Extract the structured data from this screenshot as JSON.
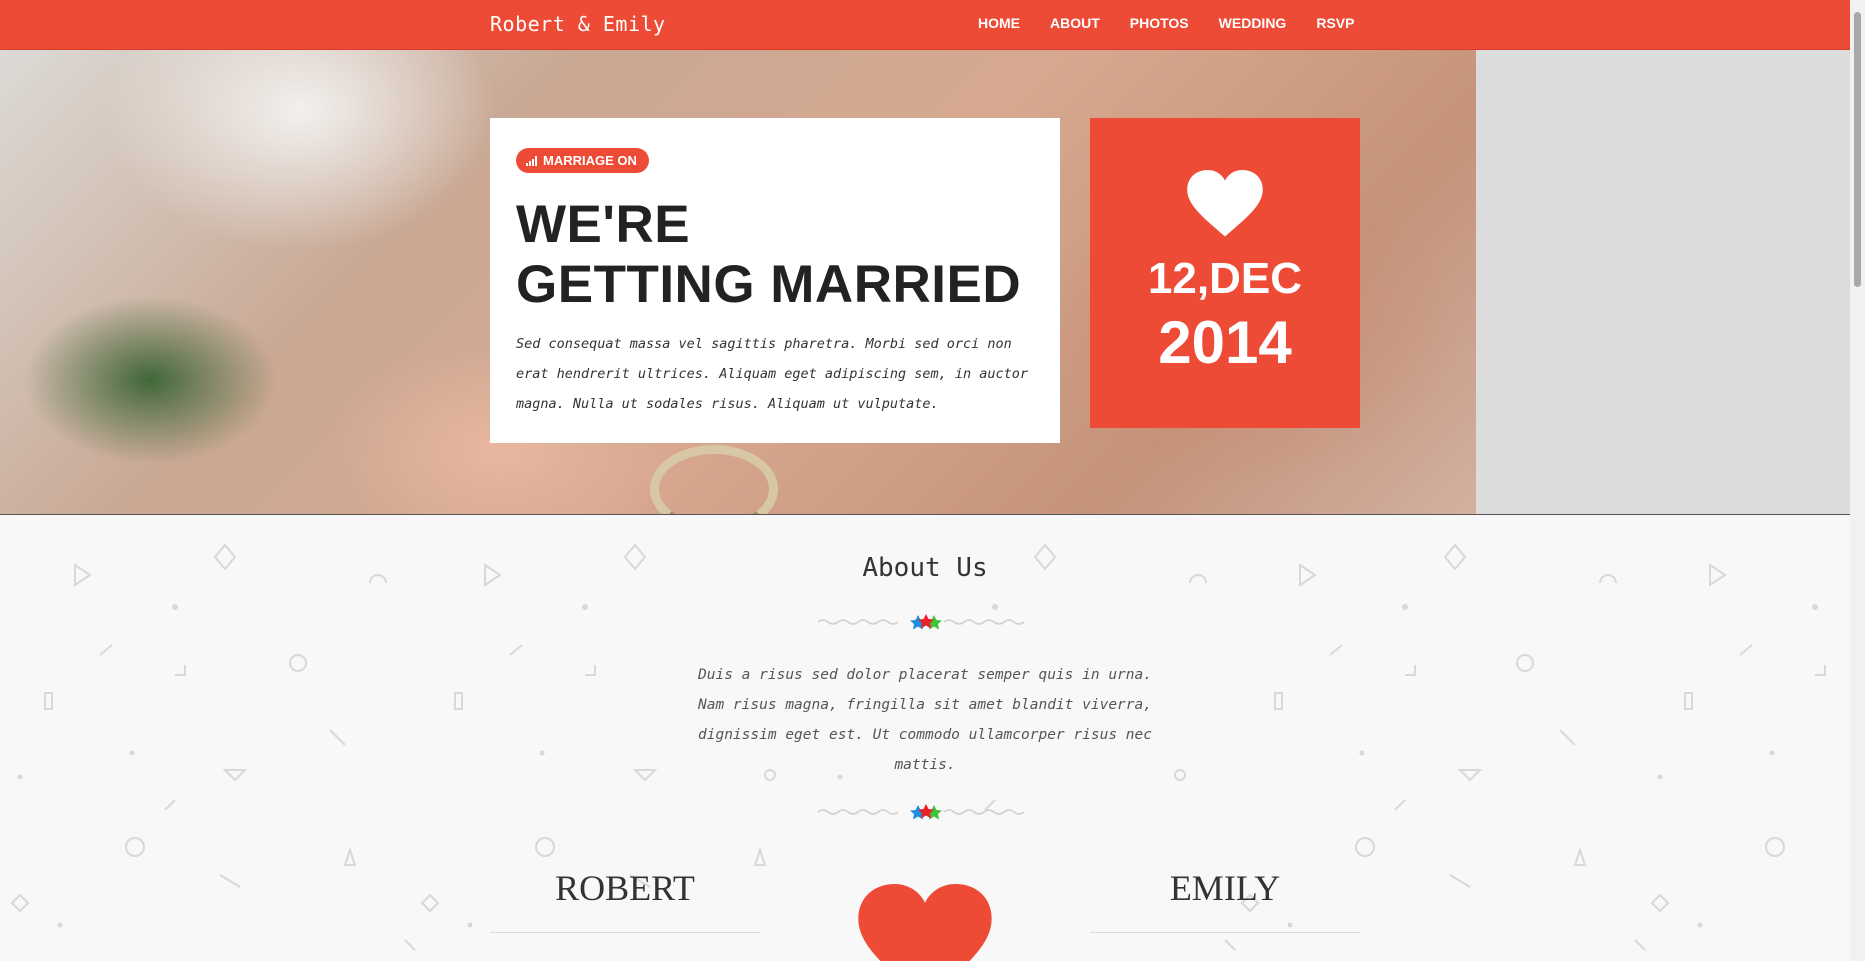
{
  "nav": {
    "brand": "Robert & Emily",
    "links": [
      "HOME",
      "ABOUT",
      "PHOTOS",
      "WEDDING",
      "RSVP"
    ]
  },
  "hero": {
    "badge": "MARRIAGE ON",
    "headline_line1": "WE'RE",
    "headline_line2": "GETTING MARRIED",
    "text": "Sed consequat massa vel sagittis pharetra. Morbi sed orci non erat hendrerit ultrices. Aliquam eget adipiscing sem, in auctor magna. Nulla ut sodales risus. Aliquam ut vulputate.",
    "date_day": "12,DEC",
    "date_year": "2014"
  },
  "about": {
    "title": "About Us",
    "text": "Duis a risus sed dolor placerat semper quis in urna. Nam risus magna, fringilla sit amet blandit viverra, dignissim eget est. Ut commodo ullamcorper risus nec mattis.",
    "groom": "ROBERT",
    "bride": "EMILY"
  },
  "colors": {
    "accent": "#ee4b37",
    "star_blue": "#1f8ce0",
    "star_red": "#e8202a",
    "star_green": "#3ec43a"
  }
}
